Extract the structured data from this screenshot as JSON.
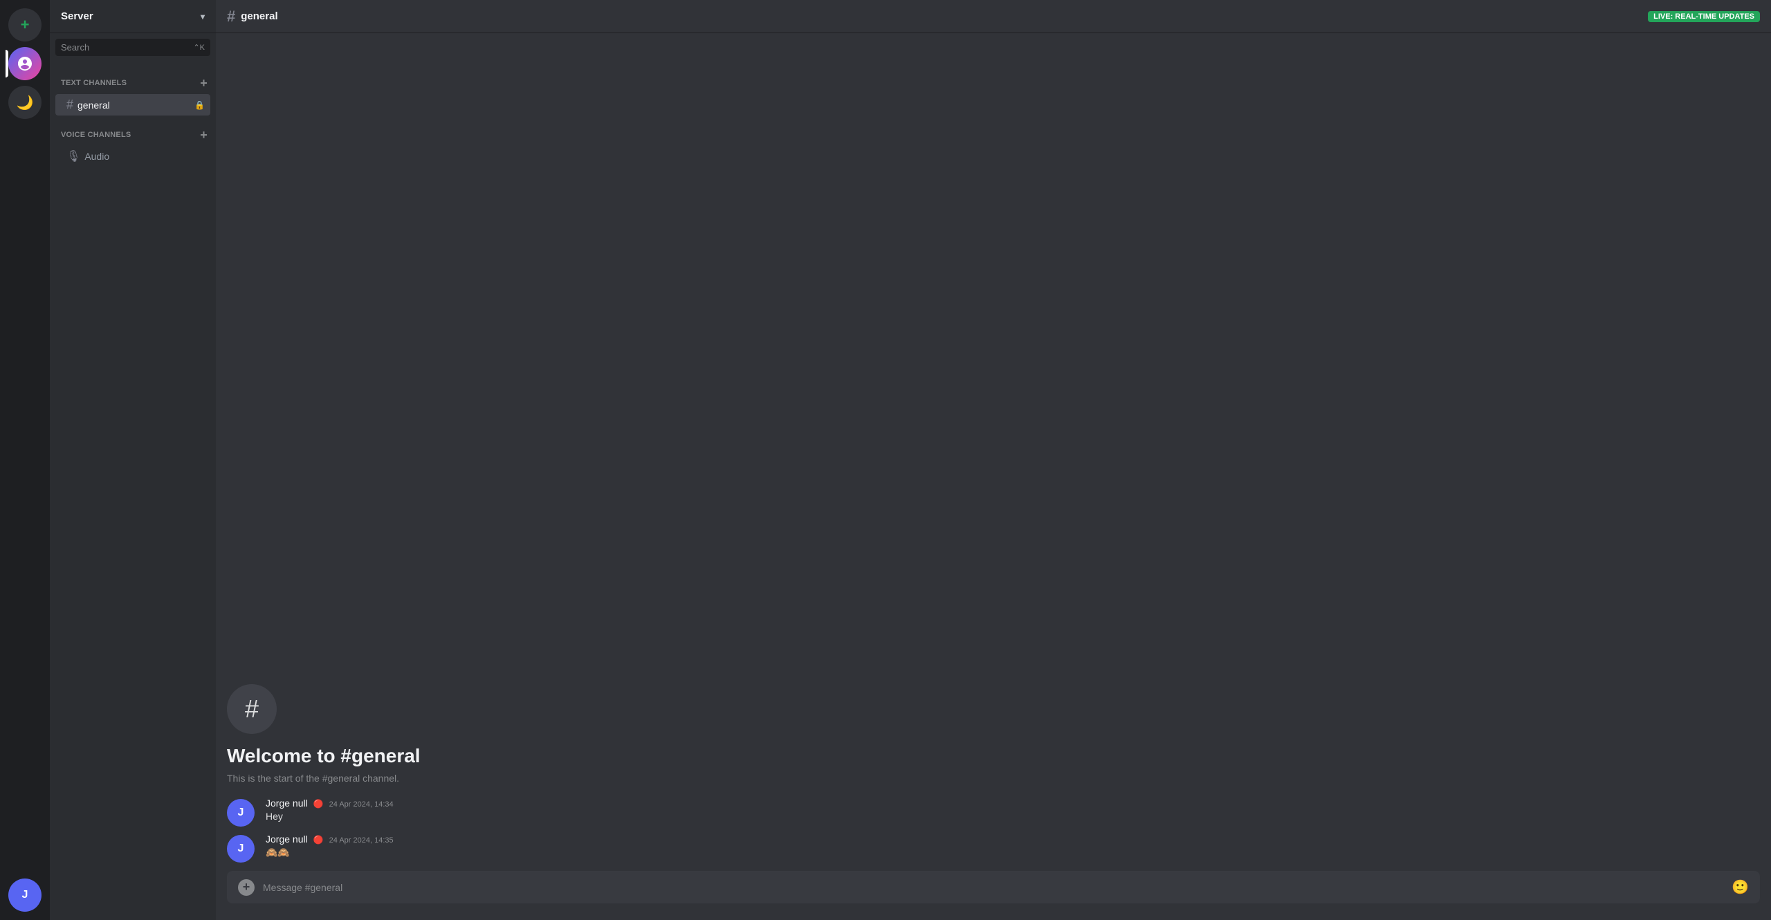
{
  "app": {
    "title": "Server"
  },
  "server_list": {
    "add_label": "+",
    "server_name": "Server",
    "user_initial": "J"
  },
  "sidebar": {
    "server_title": "Server",
    "search_placeholder": "Search",
    "search_shortcut": "⌃K",
    "text_channels_label": "TEXT CHANNELS",
    "voice_channels_label": "VOICE CHANNELS",
    "text_channels": [
      {
        "name": "general",
        "locked": true
      }
    ],
    "voice_channels": [
      {
        "name": "Audio"
      }
    ]
  },
  "header": {
    "channel_name": "general",
    "live_badge": "Live: Real-time updates"
  },
  "channel_welcome": {
    "icon": "#",
    "title": "Welcome to #general",
    "description": "This is the start of the #general channel."
  },
  "messages": [
    {
      "author": "Jorge null",
      "initial": "J",
      "timestamp": "24 Apr 2024, 14:34",
      "text": "Hey",
      "status": "🔴"
    },
    {
      "author": "Jorge null",
      "initial": "J",
      "timestamp": "24 Apr 2024, 14:35",
      "text": "🙈🙈",
      "status": "🔴"
    }
  ],
  "message_input": {
    "placeholder": "Message #general"
  }
}
